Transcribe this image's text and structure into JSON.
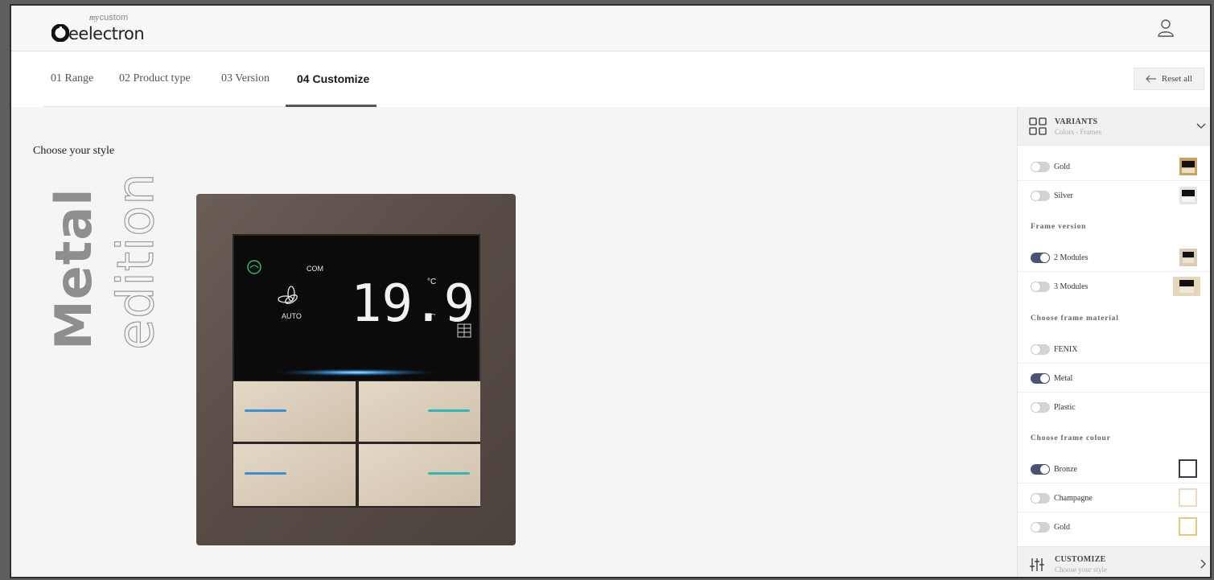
{
  "brand": {
    "name": "eelectron",
    "tagline": "custom",
    "sup_script": "my"
  },
  "steps": [
    {
      "label": "01 Range",
      "active": false
    },
    {
      "label": "02 Product type",
      "active": false
    },
    {
      "label": "03 Version",
      "active": false
    },
    {
      "label": "04 Customize",
      "active": true
    }
  ],
  "reset_label": "Reset all",
  "main": {
    "choose_title": "Choose your style",
    "side_word_bold": "Metal",
    "side_word_light": "edition"
  },
  "device": {
    "temperature": "19.9",
    "unit": "°C",
    "mode_top": "COM",
    "mode_fan": "AUTO",
    "temp_marker": "T'"
  },
  "panel": {
    "header_title": "VARIANTS",
    "header_sub": "Colors - Frames",
    "options_top": [
      {
        "label": "Gold",
        "on": false
      },
      {
        "label": "Silver",
        "on": false
      }
    ],
    "frame_version_label": "Frame version",
    "frame_version": [
      {
        "label": "2 Modules",
        "on": true
      },
      {
        "label": "3 Modules",
        "on": false
      }
    ],
    "material_label": "Choose frame material",
    "material": [
      {
        "label": "FENIX",
        "on": false
      },
      {
        "label": "Metal",
        "on": true
      },
      {
        "label": "Plastic",
        "on": false
      }
    ],
    "colour_label": "Choose frame colour",
    "colour": [
      {
        "label": "Bronze",
        "on": true,
        "swatch": "#3a3a3a"
      },
      {
        "label": "Champagne",
        "on": false,
        "swatch": "#ecd9c2"
      },
      {
        "label": "Gold",
        "on": false,
        "swatch": "#e8c77b"
      }
    ],
    "footer_title": "CUSTOMIZE",
    "footer_sub": "Choose your style"
  },
  "colors": {
    "toggle_on": "#4b5275",
    "toggle_off": "#d3d3d3",
    "frame_bronze": "#5b504a",
    "screen": "#0b0b0c",
    "key_finish": "#d9cdb8",
    "led_blue": "#3a8fd6",
    "led_teal": "#35b6b6"
  }
}
